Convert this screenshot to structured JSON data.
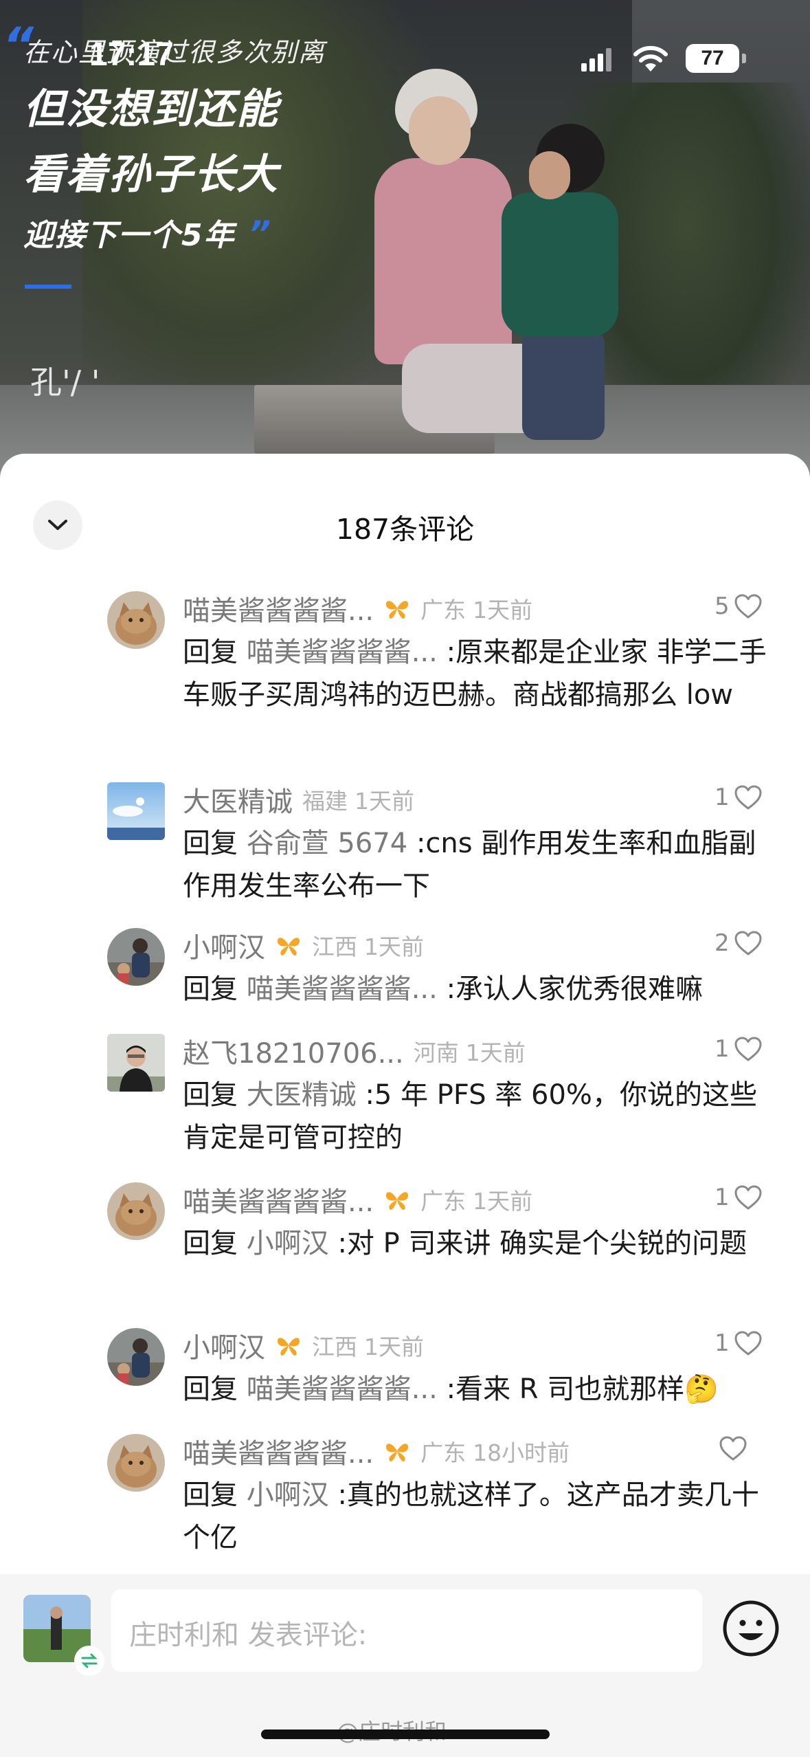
{
  "status_bar": {
    "time": "17:17",
    "battery": "77"
  },
  "video": {
    "caption_line1": "在心里预演过很多次别离",
    "caption_line2": "但没想到还能",
    "caption_line3": "看着孙子长大",
    "caption_line4": "迎接下一个5年",
    "subtitle_fragment": "孔'/ '"
  },
  "sheet": {
    "title": "187条评论"
  },
  "comments": [
    {
      "name": "喵美酱酱酱酱...",
      "badge": true,
      "region": "广东",
      "time": "1天前",
      "likes": "5",
      "reply_word": "回复",
      "reply_target": "喵美酱酱酱酱...",
      "text": ":原来都是企业家 非学二手车贩子买周鸿祎的迈巴赫。商战都搞那么 low",
      "avatar": "cat"
    },
    {
      "name": "大医精诚",
      "badge": false,
      "region": "福建",
      "time": "1天前",
      "likes": "1",
      "reply_word": "回复",
      "reply_target": "谷俞萱 5674",
      "text": ":cns 副作用发生率和血脂副作用发生率公布一下",
      "avatar": "sky"
    },
    {
      "name": "小啊汉",
      "badge": true,
      "region": "江西",
      "time": "1天前",
      "likes": "2",
      "reply_word": "回复",
      "reply_target": "喵美酱酱酱酱...",
      "text": ":承认人家优秀很难嘛",
      "avatar": "person"
    },
    {
      "name": "赵飞18210706...",
      "badge": false,
      "region": "河南",
      "time": "1天前",
      "likes": "1",
      "reply_word": "回复",
      "reply_target": "大医精诚",
      "text": ":5 年 PFS 率 60%，你说的这些肯定是可管可控的",
      "avatar": "portrait"
    },
    {
      "name": "喵美酱酱酱酱...",
      "badge": true,
      "region": "广东",
      "time": "1天前",
      "likes": "1",
      "reply_word": "回复",
      "reply_target": "小啊汉",
      "text": ":对 P 司来讲 确实是个尖锐的问题",
      "avatar": "cat"
    },
    {
      "name": "小啊汉",
      "badge": true,
      "region": "江西",
      "time": "1天前",
      "likes": "1",
      "reply_word": "回复",
      "reply_target": "喵美酱酱酱酱...",
      "text": ":看来 R 司也就那样🤔",
      "avatar": "person"
    },
    {
      "name": "喵美酱酱酱酱...",
      "badge": true,
      "region": "广东",
      "time": "18小时前",
      "likes": "",
      "reply_word": "回复",
      "reply_target": "小啊汉",
      "text": ":真的也就这样了。这产品才卖几十个亿",
      "avatar": "cat"
    }
  ],
  "input_bar": {
    "placeholder": "庄时利和 发表评论:"
  },
  "watermark": "@庄时利和",
  "colors": {
    "badge": "#f5a623",
    "accent_blue": "#2c6ee6"
  }
}
